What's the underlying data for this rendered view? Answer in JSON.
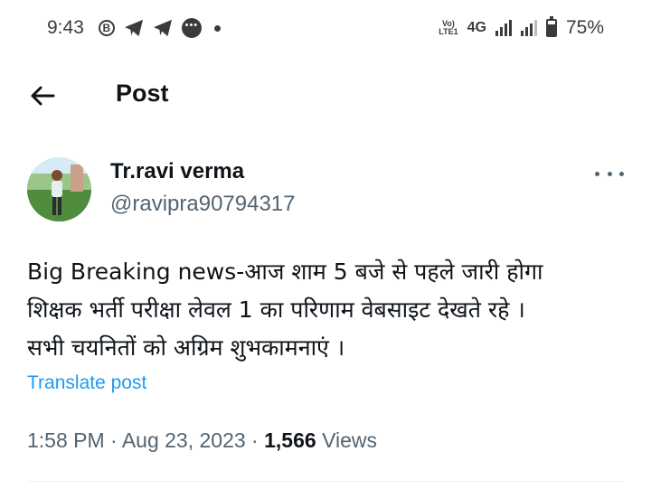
{
  "status_bar": {
    "time": "9:43",
    "b_icon_text": "B",
    "network_volte": "Vo LTE1",
    "network_type": "4G",
    "battery": "75%",
    "battery_level": 0.75,
    "icons": [
      "b-circle-icon",
      "telegram-icon",
      "telegram-icon",
      "message-bubble-icon",
      "notification-dot-icon",
      "volte-icon",
      "signal-icon",
      "signal-icon",
      "battery-icon"
    ]
  },
  "header": {
    "title": "Post",
    "back_icon": "arrow-left-icon"
  },
  "author": {
    "name": "Tr.ravi verma",
    "handle": "@ravipra90794317",
    "more_icon": "more-horizontal-icon"
  },
  "post": {
    "lines": [
      "Big Breaking news-आज शाम 5 बजे से पहले  जारी होगा",
      "शिक्षक भर्ती परीक्षा लेवल 1 का परिणाम वेबसाइट देखते रहे ।",
      "सभी चयनितों को अग्रिम शुभकामनाएं ।"
    ],
    "translate_label": "Translate post"
  },
  "meta": {
    "time": "1:58 PM",
    "separator": " · ",
    "date": "Aug 23, 2023",
    "views_count": "1,566",
    "views_label": " Views"
  },
  "colors": {
    "text_primary": "#0f1419",
    "text_secondary": "#536471",
    "link": "#1d9bf0",
    "divider": "#eff3f4"
  }
}
